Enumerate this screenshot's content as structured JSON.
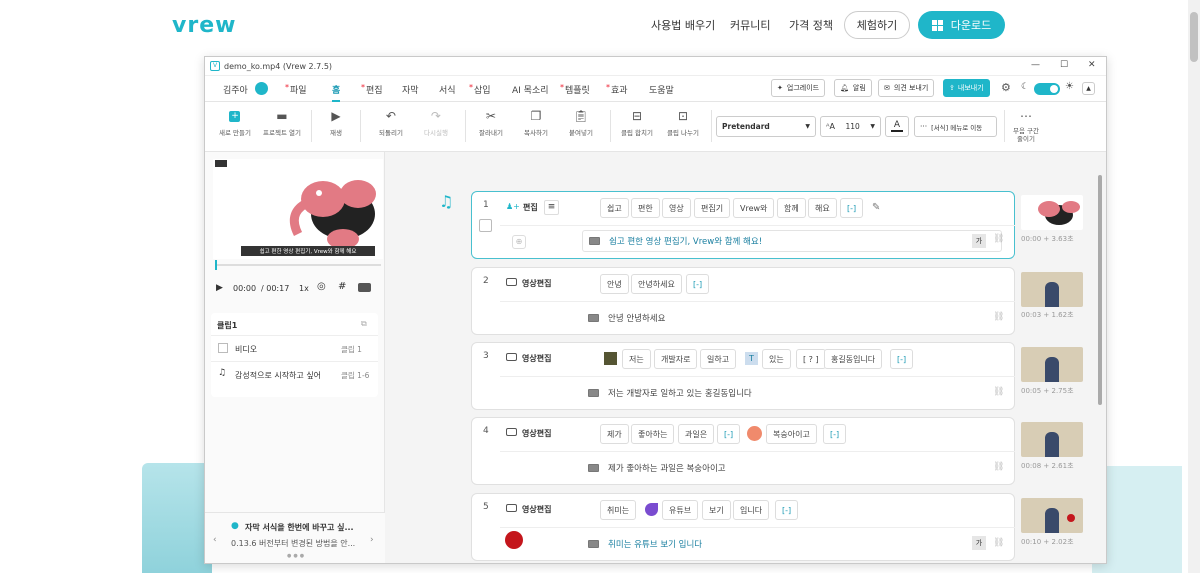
{
  "site": {
    "logo": "vrew",
    "nav": [
      "사용법 배우기",
      "커뮤니티",
      "가격 정책"
    ],
    "try_label": "체험하기",
    "download_label": "다운로드",
    "accent": "#1fb6c9"
  },
  "window": {
    "title": "demo_ko.mp4 (Vrew 2.7.5)",
    "controls": [
      "—",
      "☐",
      "✕"
    ]
  },
  "menubar": {
    "user": "김주아",
    "items": [
      {
        "label": "파일",
        "star": true
      },
      {
        "label": "홈",
        "star": false,
        "active": true
      },
      {
        "label": "편집",
        "star": true
      },
      {
        "label": "자막",
        "star": false
      },
      {
        "label": "서식",
        "star": false
      },
      {
        "label": "삽입",
        "star": true
      },
      {
        "label": "AI 목소리",
        "star": false
      },
      {
        "label": "템플릿",
        "star": true
      },
      {
        "label": "효과",
        "star": true
      },
      {
        "label": "도움말",
        "star": false
      }
    ],
    "upgrade": "업그레이드",
    "alert": "알림",
    "feedback": "의견 보내기",
    "export": "내보내기"
  },
  "toolbar": {
    "new": "새로 만들기",
    "open": "프로젝트 열기",
    "play": "재생",
    "undo": "되돌리기",
    "redo": "다시실행",
    "cut": "잘라내기",
    "copy": "복사하기",
    "paste": "붙여넣기",
    "merge": "클립 합치기",
    "split": "클립 나누기",
    "font": "Pretendard",
    "size": "110",
    "format_menu": "[서식] 메뉴로 이동",
    "silence_line1": "무음 구간",
    "silence_line2": "줄이기"
  },
  "preview": {
    "caption": "쉽고 편한 영상 편집기, Vrew와 함께 해요",
    "time_current": "00:00",
    "time_total": "/ 00:17",
    "speed": "1x",
    "progress": 0.0
  },
  "clip_panel": {
    "title": "클립1",
    "rows": [
      {
        "label": "비디오",
        "value": "클립 1"
      },
      {
        "label": "감성적으로 시작하고 싶어",
        "value": "클립 1-6"
      }
    ]
  },
  "tip": {
    "title": "자막 서식을 한번에 바꾸고 싶...",
    "body": "0.13.6 버전부터 변경된 방법을 안..."
  },
  "clips": [
    {
      "num": "1",
      "label": "편집",
      "words": [
        "쉽고",
        "편한",
        "영상",
        "편집기",
        "Vrew와",
        "함께",
        "해요",
        "[-]"
      ],
      "subtitle": "쉽고 편한 영상 편집기, Vrew와 함께 해요!",
      "time": "00:00 + 3.63초",
      "badge": "가"
    },
    {
      "num": "2",
      "label": "영상편집",
      "words": [
        "안녕",
        "안녕하세요",
        "[-]"
      ],
      "subtitle": "안녕 안녕하세요",
      "time": "00:03 + 1.62초"
    },
    {
      "num": "3",
      "label": "영상편집",
      "words": [
        "저는",
        "개발자로",
        "일하고",
        "있는",
        "[ ? ]",
        "홍길동입니다",
        "[-]"
      ],
      "subtitle": "저는 개발자로 일하고 있는 홍길동입니다",
      "time": "00:05 + 2.75초"
    },
    {
      "num": "4",
      "label": "영상편집",
      "words": [
        "제가",
        "좋아하는",
        "과일은",
        "[-]",
        "복숭아이고",
        "[-]"
      ],
      "subtitle": "제가 좋아하는 과일은 복숭아이고",
      "time": "00:08 + 2.61초"
    },
    {
      "num": "5",
      "label": "영상편집",
      "words": [
        "취미는",
        "유튜브",
        "보기",
        "입니다",
        "[-]"
      ],
      "subtitle": "취미는 유튜브 보기 입니다",
      "time": "00:10 + 2.02초",
      "badge": "가"
    }
  ]
}
